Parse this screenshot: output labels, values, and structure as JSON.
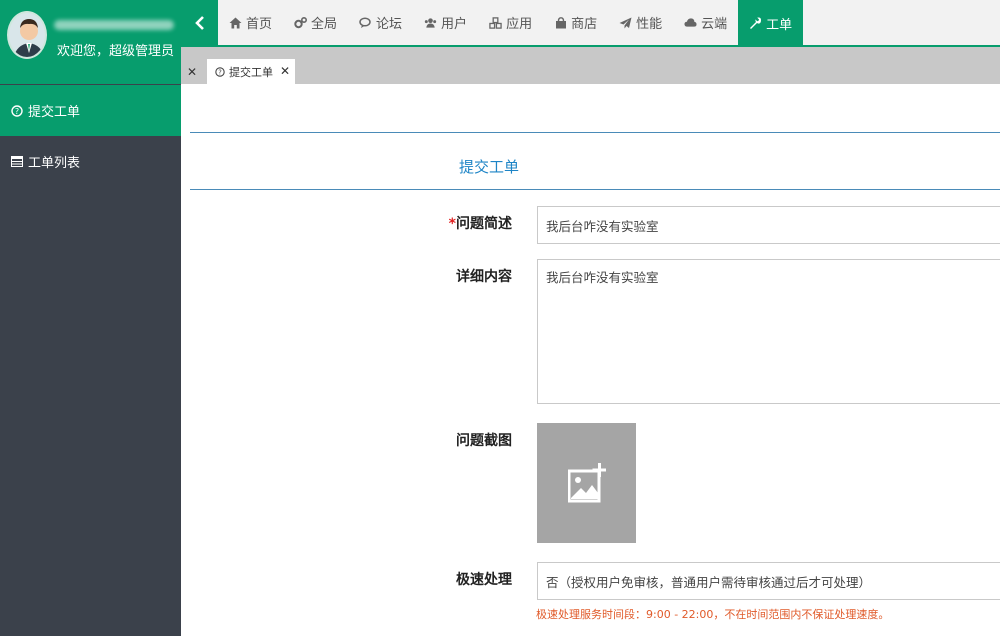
{
  "user": {
    "welcome": "欢迎您，超级管理员"
  },
  "sidebar": {
    "items": [
      {
        "label": "提交工单",
        "icon": "question-circle-icon"
      },
      {
        "label": "工单列表",
        "icon": "list-icon"
      }
    ]
  },
  "topnav": {
    "items": [
      {
        "label": "首页",
        "icon": "home-icon"
      },
      {
        "label": "全局",
        "icon": "cogs-icon"
      },
      {
        "label": "论坛",
        "icon": "comments-icon"
      },
      {
        "label": "用户",
        "icon": "users-icon"
      },
      {
        "label": "应用",
        "icon": "cubes-icon"
      },
      {
        "label": "商店",
        "icon": "shopping-bag-icon"
      },
      {
        "label": "性能",
        "icon": "paper-plane-icon"
      },
      {
        "label": "云端",
        "icon": "cloud-icon"
      },
      {
        "label": "工单",
        "icon": "wrench-icon"
      }
    ]
  },
  "tabs": [
    {
      "label": "提交工单"
    }
  ],
  "form": {
    "title": "提交工单",
    "required_mark": "*",
    "summary_label": "问题简述",
    "summary_value": "我后台咋没有实验室",
    "detail_label": "详细内容",
    "detail_value": "我后台咋没有实验室",
    "screenshot_label": "问题截图",
    "speed_label": "极速处理",
    "speed_value": "否（授权用户免审核，普通用户需待审核通过后才可处理）",
    "speed_hint": "极速处理服务时间段：9:00 - 22:00，不在时间范围内不保证处理速度。"
  },
  "colors": {
    "accent": "#079d6d",
    "sidebar_bg": "#3b414b",
    "title_blue": "#1d84c6",
    "hint_red": "#e05a2a"
  }
}
